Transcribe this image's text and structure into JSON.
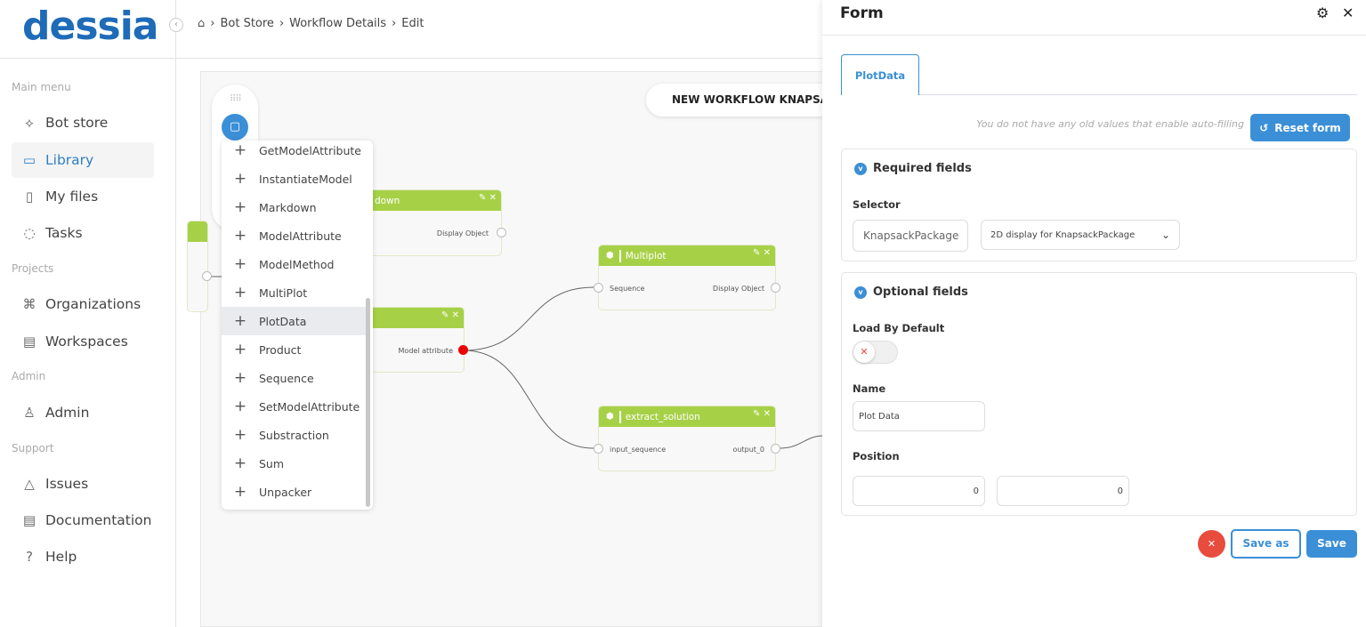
{
  "brand": {
    "logo": "dessia"
  },
  "breadcrumb": [
    "Bot Store",
    "Workflow Details",
    "Edit"
  ],
  "sidebar": {
    "sections": {
      "main": "Main menu",
      "projects": "Projects",
      "admin": "Admin",
      "support": "Support"
    },
    "items": [
      {
        "label": "Bot store",
        "icon": "workflow-icon"
      },
      {
        "label": "Library",
        "icon": "folder-icon",
        "active": true
      },
      {
        "label": "My files",
        "icon": "file-icon"
      },
      {
        "label": "Tasks",
        "icon": "check-circle-icon"
      },
      {
        "label": "Organizations",
        "icon": "org-chart-icon"
      },
      {
        "label": "Workspaces",
        "icon": "briefcase-icon"
      },
      {
        "label": "Admin",
        "icon": "user-gear-icon"
      },
      {
        "label": "Issues",
        "icon": "warning-icon"
      },
      {
        "label": "Documentation",
        "icon": "book-icon"
      },
      {
        "label": "Help",
        "icon": "help-icon"
      }
    ]
  },
  "workflow": {
    "title": "NEW WORKFLOW KNAPSACK",
    "nodes": {
      "markdown": {
        "title": "down",
        "output": "Display Object"
      },
      "model_attr": {
        "output": "Model attribute"
      },
      "multiplot": {
        "title": "Multiplot",
        "input": "Sequence",
        "output": "Display Object"
      },
      "extract": {
        "title": "extract_solution",
        "input": "input_sequence",
        "output": "output_0"
      }
    }
  },
  "add_menu": {
    "items": [
      "GetModelAttribute",
      "InstantiateModel",
      "Markdown",
      "ModelAttribute",
      "ModelMethod",
      "MultiPlot",
      "PlotData",
      "Product",
      "Sequence",
      "SetModelAttribute",
      "Substraction",
      "Sum",
      "Unpacker"
    ],
    "highlighted": "PlotData"
  },
  "form": {
    "title": "Form",
    "tab": "PlotData",
    "hint": "You do not have any old values that enable auto-filling",
    "reset_label": "Reset form",
    "required": {
      "title": "Required fields",
      "selector_label": "Selector",
      "selector_class": "KnapsackPackage",
      "selector_value": "2D display for KnapsackPackage"
    },
    "optional": {
      "title": "Optional fields",
      "load_by_default_label": "Load By Default",
      "load_by_default": false,
      "name_label": "Name",
      "name_value": "Plot Data",
      "position_label": "Position",
      "position_x": "0",
      "position_y": "0"
    },
    "save_as_label": "Save as",
    "save_label": "Save"
  },
  "colors": {
    "accent": "#3b8fd6",
    "node_header": "#a6d147",
    "danger": "#e84c3d"
  }
}
